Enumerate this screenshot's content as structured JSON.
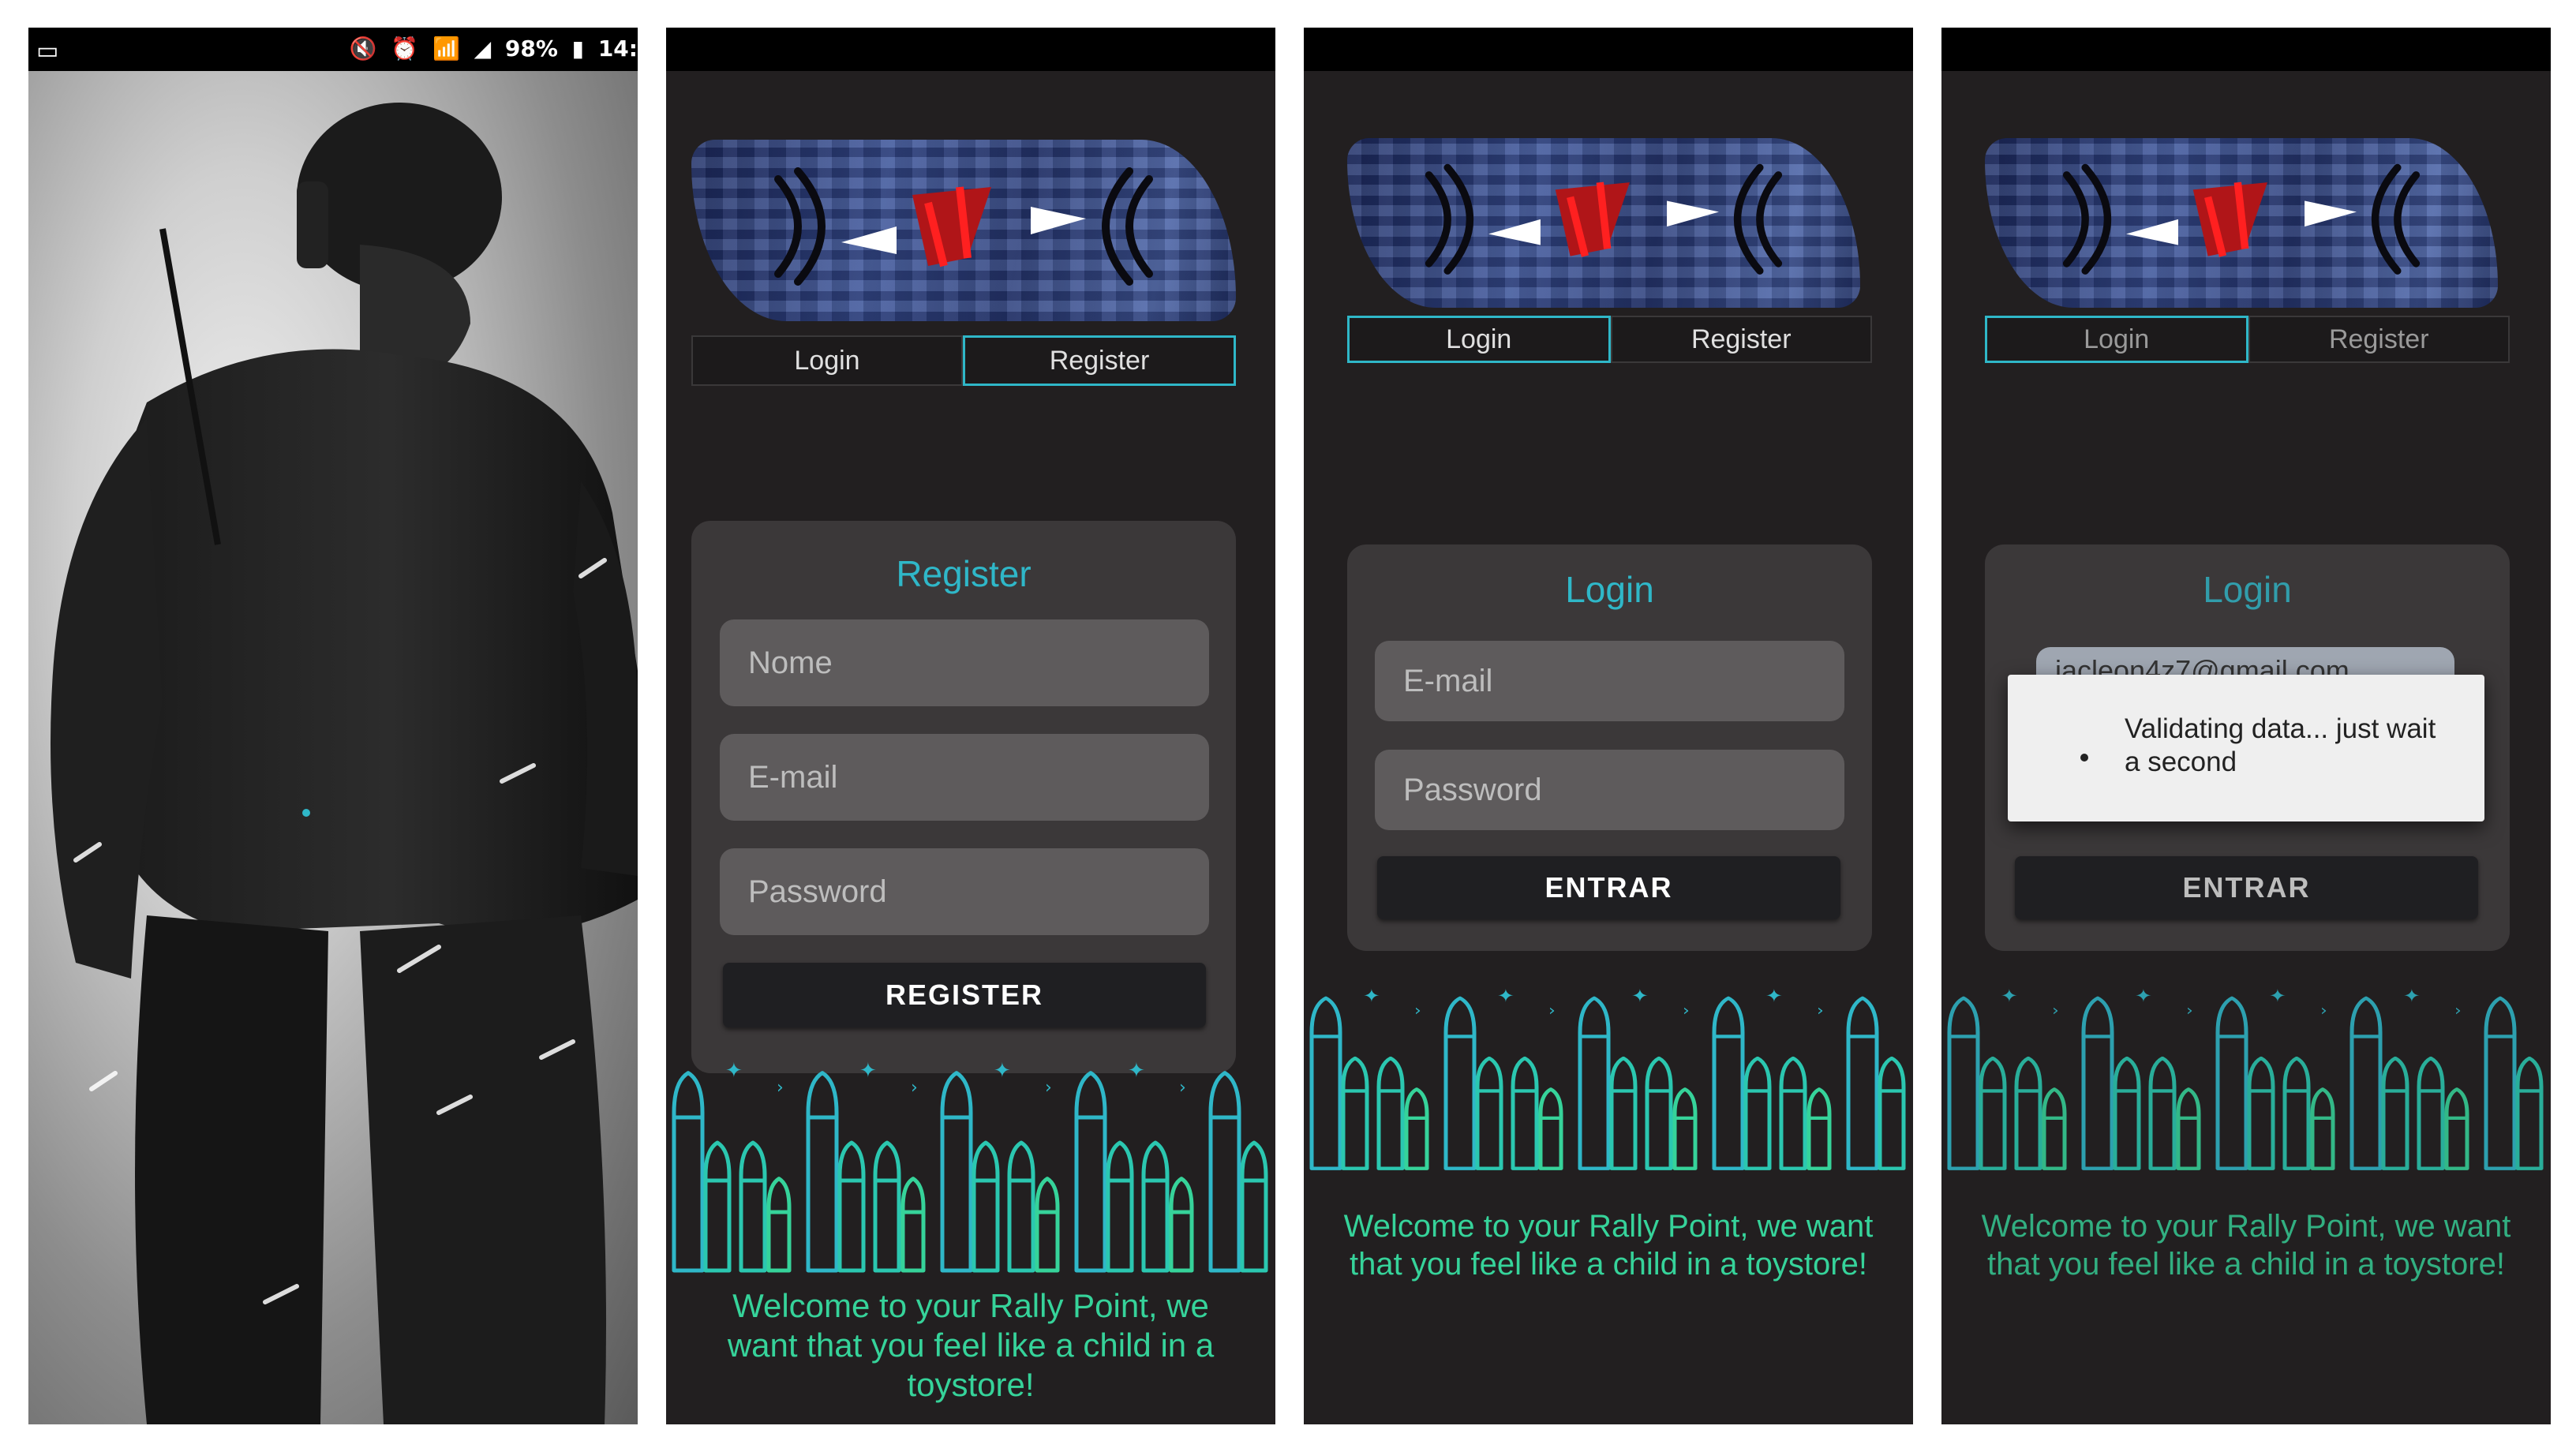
{
  "status_bar": {
    "left_icon": "screen-icon",
    "mute": "🔇",
    "alarm": "⏰",
    "wifi": "📶",
    "signal": "◢",
    "battery_text": "98%",
    "battery_icon": "▮",
    "time": "14:"
  },
  "screen_register": {
    "tabs": [
      {
        "label": "Login",
        "active": false
      },
      {
        "label": "Register",
        "active": true
      }
    ],
    "title": "Register",
    "fields": {
      "name_placeholder": "Nome",
      "email_placeholder": "E-mail",
      "password_placeholder": "Password"
    },
    "button": "REGISTER",
    "welcome": "Welcome to your Rally Point, we want that you feel like a child in a toystore!"
  },
  "screen_login": {
    "tabs": [
      {
        "label": "Login",
        "active": true
      },
      {
        "label": "Register",
        "active": false
      }
    ],
    "title": "Login",
    "fields": {
      "email_placeholder": "E-mail",
      "password_placeholder": "Password"
    },
    "button": "ENTRAR",
    "welcome": "Welcome to your Rally Point, we want that you feel like a child in a toystore!"
  },
  "screen_validating": {
    "tabs": [
      {
        "label": "Login",
        "active": true
      },
      {
        "label": "Register",
        "active": false
      }
    ],
    "title": "Login",
    "email_value": "jacleon4z7@gmail.com",
    "dialog_message": "Validating data... just wait a second",
    "button": "ENTRAR",
    "welcome": "Welcome to your Rally Point, we want that you feel like a child in a toystore!"
  },
  "colors": {
    "accent": "#2fb7c8",
    "welcome": "#36d39a",
    "background": "#221f20",
    "card": "#3b3839",
    "field": "#5e5b5c"
  }
}
